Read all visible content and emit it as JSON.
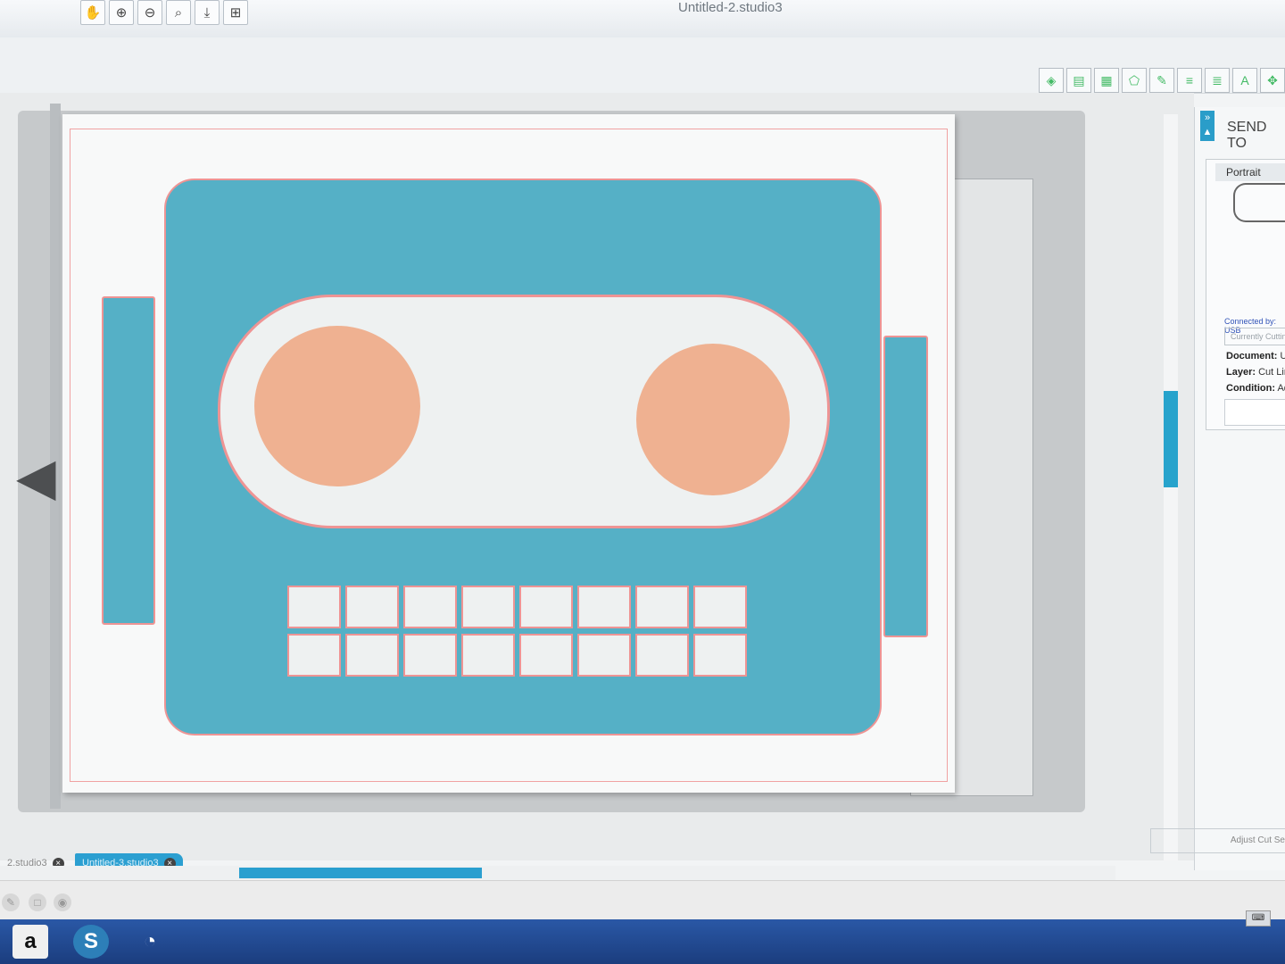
{
  "window": {
    "title": "Untitled-2.studio3"
  },
  "top_toolbar": {
    "tools": [
      {
        "icon": "pan-hand-icon",
        "glyph": "✋"
      },
      {
        "icon": "zoom-in-icon",
        "glyph": "⊕"
      },
      {
        "icon": "zoom-out-icon",
        "glyph": "⊖"
      },
      {
        "icon": "zoom-select-icon",
        "glyph": "⌕"
      },
      {
        "icon": "fit-page-icon",
        "glyph": "⤓"
      },
      {
        "icon": "fit-window-icon",
        "glyph": "⊞"
      }
    ]
  },
  "right_toolbar": {
    "tools": [
      {
        "icon": "fill-color-icon",
        "glyph": "◈"
      },
      {
        "icon": "gradient-icon",
        "glyph": "▤"
      },
      {
        "icon": "pattern-icon",
        "glyph": "▦"
      },
      {
        "icon": "shape-icon",
        "glyph": "⬠"
      },
      {
        "icon": "sketch-icon",
        "glyph": "✎"
      },
      {
        "icon": "line-color-icon",
        "glyph": "≡"
      },
      {
        "icon": "line-style-icon",
        "glyph": "≣"
      },
      {
        "icon": "text-style-icon",
        "glyph": "A"
      },
      {
        "icon": "transform-icon",
        "glyph": "✥"
      }
    ]
  },
  "send_panel": {
    "title": "SEND TO",
    "orientation_tab": "Portrait",
    "connected_by": "Connected by: USB",
    "status": "Currently Cutting",
    "document_label": "Document:",
    "document_value": "Un",
    "layer_label": "Layer:",
    "layer_value": "Cut Line",
    "condition_label": "Condition:",
    "condition_value": "Adh",
    "adjust_button": "Adjust Cut Se"
  },
  "doc_tabs": [
    {
      "label": "2.studio3",
      "active": false
    },
    {
      "label": "Untitled-3.studio3",
      "active": true
    }
  ],
  "taskbar": {
    "apps": [
      {
        "name": "amazon-icon",
        "glyph": "a"
      },
      {
        "name": "silhouette-studio-icon",
        "glyph": "S"
      },
      {
        "name": "browser-icon",
        "glyph": "◔"
      }
    ],
    "keyboard_glyph": "⌨"
  },
  "colors": {
    "accent": "#2b9fd1",
    "robot_body": "#55b0c6",
    "robot_eyes": "#efb191",
    "cut_line": "#ee9494",
    "taskbar": "#1f4a93"
  }
}
